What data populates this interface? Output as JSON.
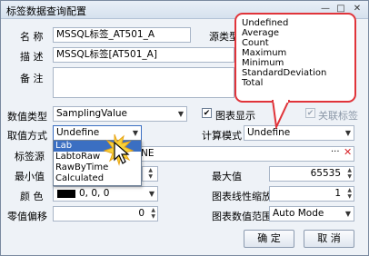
{
  "window": {
    "title": "标签数据查询配置",
    "min": "—",
    "max": "□",
    "close": "✕"
  },
  "form": {
    "name_label": "名 称",
    "name_value": "MSSQL标签_AT501_A",
    "desc_label": "描 述",
    "desc_value": "MSSQL标签[AT501_A]",
    "note_label": "备 注",
    "source_label_partial": "源类型",
    "value_type_label": "数值类型",
    "value_type_value": "SamplingValue",
    "chart_display_label": "图表显示",
    "assoc_label": "关联标签",
    "fetch_label": "取值方式",
    "fetch_value": "Undefine",
    "calc_label": "计算模式",
    "calc_value": "Undefine",
    "tag_src_label": "标签源",
    "tag_src_value": "NE",
    "min_label": "最小值",
    "max_label": "最大值",
    "max_value": "65535",
    "color_label": "颜 色",
    "color_value": "0, 0, 0",
    "color_swatch": "#000000",
    "scale_label": "图表线性缩放",
    "scale_value": "1",
    "offset_label": "零值偏移",
    "offset_value": "0",
    "range_label": "图表数值范围",
    "range_value": "Auto Mode"
  },
  "fetch_dropdown": {
    "options": [
      "Lab",
      "LabtoRaw",
      "RawByTime",
      "Calculated"
    ]
  },
  "calc_callout": {
    "options": [
      "Undefined",
      "Average",
      "Count",
      "Maximum",
      "Minimum",
      "StandardDeviation",
      "Total"
    ],
    "border_color": "#e0343a"
  },
  "buttons": {
    "ok": "确 定",
    "cancel": "取 消"
  },
  "tag_src_buttons": {
    "more": "···",
    "clear": "✕"
  }
}
